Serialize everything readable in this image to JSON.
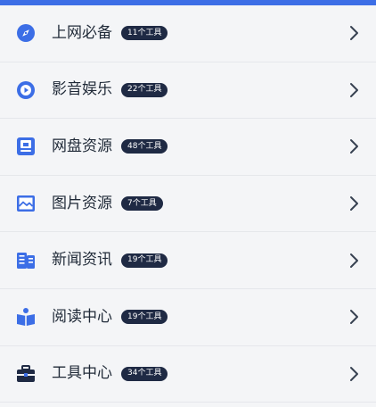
{
  "colors": {
    "accent": "#3c6ee6",
    "badge_bg": "#1f2a44",
    "text": "#1f2937",
    "chevron": "#374151"
  },
  "items": [
    {
      "label": "上网必备",
      "badge": "11个工具",
      "icon": "compass-icon"
    },
    {
      "label": "影音娱乐",
      "badge": "22个工具",
      "icon": "play-icon"
    },
    {
      "label": "网盘资源",
      "badge": "48个工具",
      "icon": "disk-icon"
    },
    {
      "label": "图片资源",
      "badge": "7个工具",
      "icon": "image-icon"
    },
    {
      "label": "新闻资讯",
      "badge": "19个工具",
      "icon": "news-icon"
    },
    {
      "label": "阅读中心",
      "badge": "19个工具",
      "icon": "book-icon"
    },
    {
      "label": "工具中心",
      "badge": "34个工具",
      "icon": "toolbox-icon"
    }
  ]
}
